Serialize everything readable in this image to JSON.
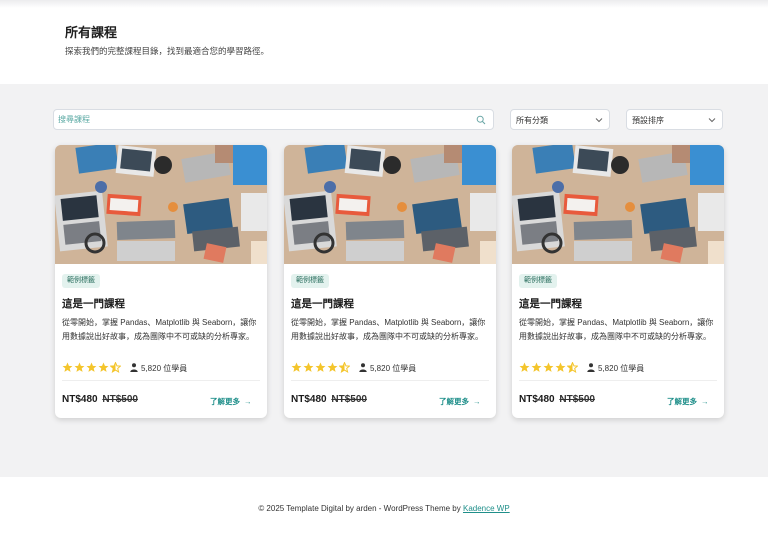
{
  "header": {
    "title": "所有課程",
    "subtitle": "探索我們的完整課程目錄，找到最適合您的學習路徑。"
  },
  "filters": {
    "search_placeholder": "搜尋課程",
    "category_selected": "所有分類",
    "sort_selected": "預設排序"
  },
  "courses": [
    {
      "tag": "範例標籤",
      "title": "這是一門課程",
      "description": "從零開始，掌握 Pandas、Matplotlib 與 Seaborn，讓你用數據說出好故事，成為團隊中不可或缺的分析專家。",
      "rating": 4.5,
      "students": "5,820 位學員",
      "price": "NT$480",
      "original_price": "NT$500",
      "cta": "了解更多"
    },
    {
      "tag": "範例標籤",
      "title": "這是一門課程",
      "description": "從零開始，掌握 Pandas、Matplotlib 與 Seaborn，讓你用數據說出好故事，成為團隊中不可或缺的分析專家。",
      "rating": 4.5,
      "students": "5,820 位學員",
      "price": "NT$480",
      "original_price": "NT$500",
      "cta": "了解更多"
    },
    {
      "tag": "範例標籤",
      "title": "這是一門課程",
      "description": "從零開始，掌握 Pandas、Matplotlib 與 Seaborn，讓你用數據說出好故事，成為團隊中不可或缺的分析專家。",
      "rating": 4.5,
      "students": "5,820 位學員",
      "price": "NT$480",
      "original_price": "NT$500",
      "cta": "了解更多"
    }
  ],
  "footer": {
    "text": "© 2025 Template Digital by arden - WordPress Theme by",
    "link_text": "Kadence WP"
  },
  "colors": {
    "accent": "#1f8f8a",
    "star": "#f4c52c",
    "tag_bg": "#e3f2ee",
    "page_bg": "#f2f2f3"
  }
}
